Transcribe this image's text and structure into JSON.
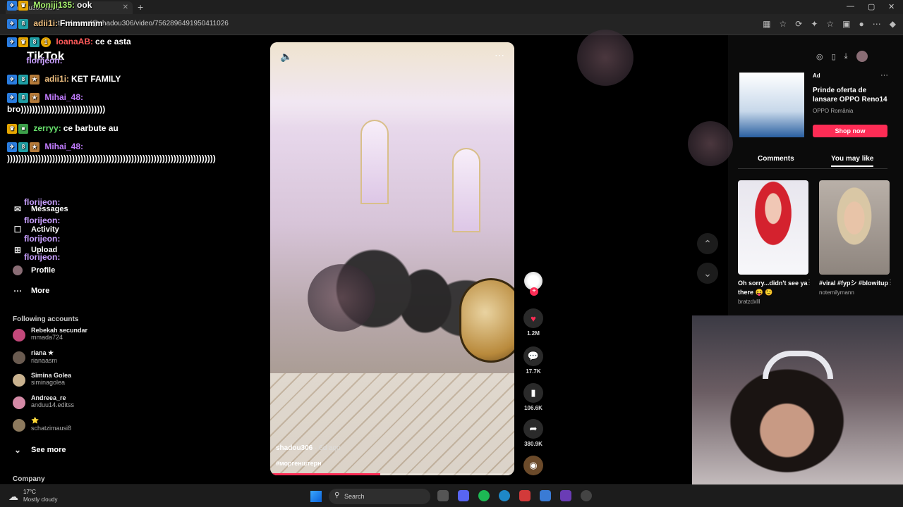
{
  "browser": {
    "tab_title": "shadou306 video",
    "url": "tiktok.com/@shadou306/video/7562896491950411026",
    "new_tab_symbol": "+"
  },
  "tiktok": {
    "logo": "TikTok",
    "nav": [
      {
        "icon": "chat-bubble-icon",
        "label": "Messages"
      },
      {
        "icon": "activity-icon",
        "label": "Activity"
      },
      {
        "icon": "upload-icon",
        "label": "Upload"
      },
      {
        "icon": "profile-icon",
        "label": "Profile"
      },
      {
        "icon": "more-icon",
        "label": "More"
      }
    ],
    "following_header": "Following accounts",
    "following": [
      {
        "name": "Rebekah secundar",
        "handle": "mmada724"
      },
      {
        "name": "riana ★",
        "handle": "rianaasm"
      },
      {
        "name": "Simina Golea",
        "handle": "siminagolea"
      },
      {
        "name": "Andreea_re",
        "handle": "anduu14.editss"
      },
      {
        "name": "⭐",
        "handle": "schatzimausi8"
      }
    ],
    "see_more": "See more",
    "company": "Company"
  },
  "video": {
    "author": "shadou306",
    "ago": " · 6d ago",
    "hashtag": "#моргенштерн",
    "progress": 0.45,
    "actions": {
      "likes": "1.2M",
      "comments": "17.7K",
      "saves": "106.6K",
      "shares": "380.9K"
    }
  },
  "ad": {
    "label": "Ad",
    "title": "Prinde oferta de lansare OPPO Reno14",
    "brand": "OPPO România",
    "cta": "Shop now"
  },
  "right_tabs": [
    "Comments",
    "You may like"
  ],
  "suggestions": [
    {
      "title": "Oh sorry...didn't see ya there 😝 😉",
      "user": "bratzdxlll"
    },
    {
      "title": "#viral #fypシ #blowitup",
      "user": "notemilymann"
    }
  ],
  "chat": [
    {
      "user": "Moniji135:",
      "msg": "ook",
      "color": "#a6f06e"
    },
    {
      "user": "adii1i:",
      "msg": "Fmmmmm",
      "color": "#f0c080"
    },
    {
      "user": "IoanaAB:",
      "msg": "ce e asta",
      "color": "#ff5a5a"
    },
    {
      "user": "florijeon:",
      "msg": "",
      "color": "#c9a0ff"
    },
    {
      "user": "adii1i:",
      "msg": "KET FAMILY",
      "color": "#f0c080"
    },
    {
      "user": "Mihai_48:",
      "msg": "",
      "color": "#c27cff"
    },
    {
      "user": "zerryy:",
      "msg": "ce barbute au",
      "color": "#67e06c"
    },
    {
      "user": "Mihai_48:",
      "msg": "",
      "color": "#c27cff"
    },
    {
      "user": "florijeon:",
      "msg": "",
      "color": "#c9a0ff"
    },
    {
      "user": "florijeon:",
      "msg": "",
      "color": "#c9a0ff"
    },
    {
      "user": "florijeon:",
      "msg": "",
      "color": "#c9a0ff"
    },
    {
      "user": "florijeon:",
      "msg": "",
      "color": "#c9a0ff"
    }
  ],
  "chat_long_1": "bro))))))))))))))))))))))))))))))",
  "chat_long_2": "))))))))))))))))))))))))))))))))))))))))))))))))))))))))))))))))))))))))))",
  "taskbar": {
    "temp": "17°C",
    "weather": "Mostly cloudy",
    "search": "Search"
  },
  "colors": {
    "accent": "#fe2c55",
    "background": "#000000"
  }
}
